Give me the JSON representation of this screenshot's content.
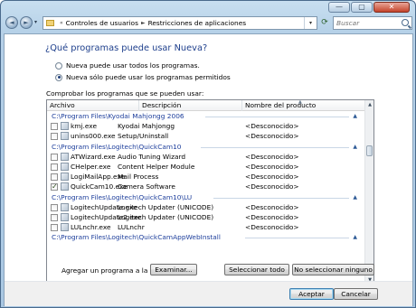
{
  "window": {
    "controls": {
      "minimize": "—",
      "maximize": "▢",
      "close": "✕"
    }
  },
  "nav": {
    "back_icon": "◄",
    "forward_icon": "►",
    "dropdown_icon": "▾",
    "breadcrumbs": [
      "Controles de usuarios",
      "Restricciones de aplicaciones"
    ],
    "breadcrumb_separator": "►",
    "refresh_icon": "⟳",
    "search_placeholder": "Buscar"
  },
  "page": {
    "heading": "¿Qué programas puede usar Nueva?",
    "radio_all": "Nueva puede usar todos los programas.",
    "radio_allowed": "Nueva sólo puede usar los programas permitidos",
    "selected_radio": "radio_allowed",
    "list_label": "Comprobar los programas que se pueden usar:"
  },
  "list": {
    "columns": [
      "Archivo",
      "Descripción",
      "Nombre del producto"
    ],
    "rows": [
      {
        "type": "group",
        "path": "C:\\Program Files\\Kyodai Mahjongg 2006"
      },
      {
        "type": "item",
        "file": "kmj.exe",
        "desc": "Kyodai Mahjongg",
        "product": "<Desconocido>",
        "checked": false
      },
      {
        "type": "item",
        "file": "unins000.exe",
        "desc": "Setup/Uninstall",
        "product": "<Desconocido>",
        "checked": false
      },
      {
        "type": "group",
        "path": "C:\\Program Files\\Logitech\\QuickCam10"
      },
      {
        "type": "item",
        "file": "ATWizard.exe",
        "desc": "Audio Tuning Wizard",
        "product": "<Desconocido>",
        "checked": false
      },
      {
        "type": "item",
        "file": "CHelper.exe",
        "desc": "Content Helper Module",
        "product": "<Desconocido>",
        "checked": false
      },
      {
        "type": "item",
        "file": "LogiMailApp.exe",
        "desc": "Mail Process",
        "product": "<Desconocido>",
        "checked": false
      },
      {
        "type": "item",
        "file": "QuickCam10.exe",
        "desc": "Camera Software",
        "product": "<Desconocido>",
        "checked": true
      },
      {
        "type": "group",
        "path": "C:\\Program Files\\Logitech\\QuickCam10\\LU"
      },
      {
        "type": "item",
        "file": "LogitechUpdate.exe",
        "desc": "Logitech Updater (UNICODE)",
        "product": "<Desconocido>",
        "checked": false
      },
      {
        "type": "item",
        "file": "LogitechUpdate2.exe",
        "desc": "Logitech Updater (UNICODE)",
        "product": "<Desconocido>",
        "checked": false
      },
      {
        "type": "item",
        "file": "LULnchr.exe",
        "desc": "LULnchr",
        "product": "<Desconocido>",
        "checked": false
      },
      {
        "type": "group",
        "path": "C:\\Program Files\\Logitech\\QuickCamAppWebInstall"
      }
    ],
    "collapse_icon": "▲"
  },
  "actions": {
    "add_label": "Agregar un programa a la lista:",
    "browse": "Examinar...",
    "select_all": "Seleccionar todo",
    "select_none": "No seleccionar ninguno",
    "accept": "Aceptar",
    "cancel": "Cancelar"
  }
}
